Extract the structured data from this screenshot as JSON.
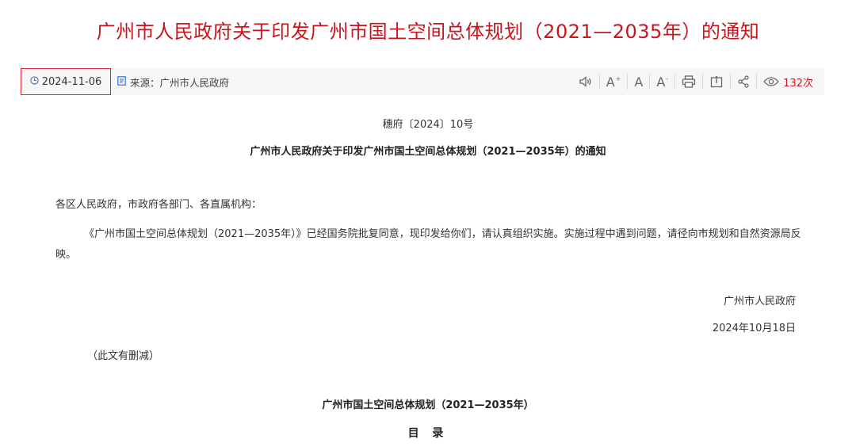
{
  "title": "广州市人民政府关于印发广州市国土空间总体规划（2021—2035年）的通知",
  "meta": {
    "date": "2024-11-06",
    "source": "来源：广州市人民政府",
    "views": "132次",
    "icons": [
      "clock-icon",
      "source-icon",
      "speaker-icon",
      "font-increase-icon",
      "font-reset-icon",
      "font-decrease-icon",
      "print-icon",
      "share-out-icon",
      "share-icon",
      "eye-icon"
    ],
    "accent_color": "#c8161e",
    "highlight_border_color": "#e0262b"
  },
  "document": {
    "number": "穗府〔2024〕10号",
    "heading": "广州市人民政府关于印发广州市国土空间总体规划（2021—2035年）的通知",
    "salutation": "各区人民政府，市政府各部门、各直属机构：",
    "body": "《广州市国土空间总体规划（2021—2035年）》已经国务院批复同意，现印发给你们，请认真组织实施。实施过程中遇到问题，请径向市规划和自然资源局反映。",
    "signature_org": "广州市人民政府",
    "signature_date": "2024年10月18日",
    "note": "（此文有删减）",
    "plan_title": "广州市国土空间总体规划（2021—2035年）",
    "toc_label": "目 录"
  }
}
